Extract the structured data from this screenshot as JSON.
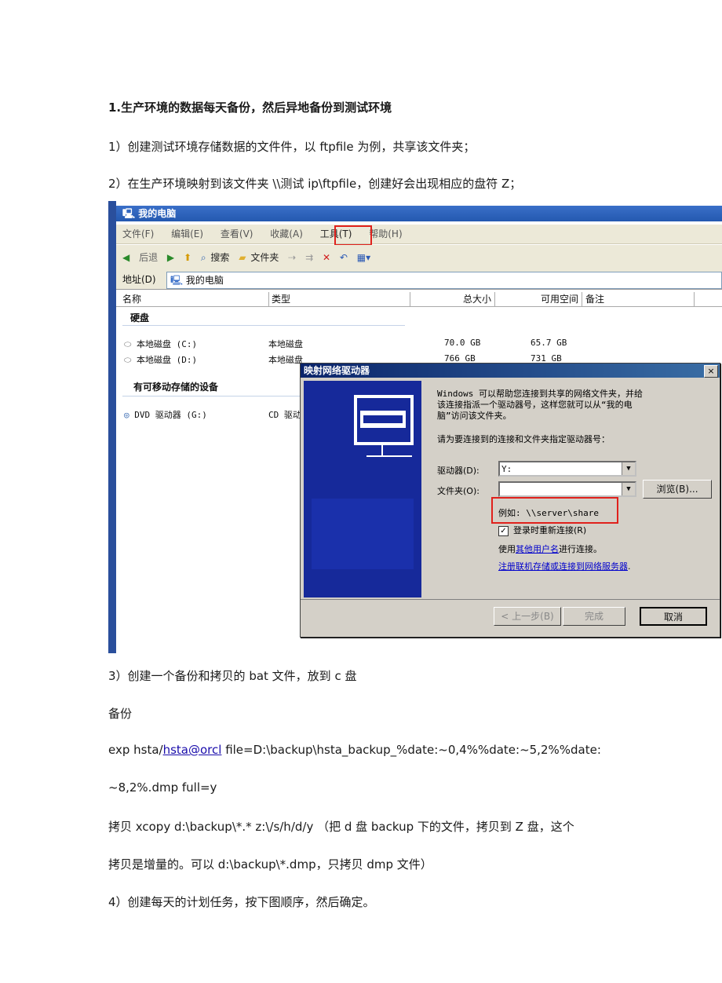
{
  "doc": {
    "heading": "1.生产环境的数据每天备份，然后异地备份到测试环境",
    "step1": "1）创建测试环境存储数据的文件件，以 ftpfile 为例，共享该文件夹；",
    "step2": "2）在生产环境映射到该文件夹 \\\\测试 ip\\ftpfile，创建好会出现相应的盘符 Z；",
    "step3": "3）创建一个备份和拷贝的 bat 文件，放到 c 盘",
    "backup_label": "备份",
    "exp_prefix": "exp hsta/",
    "exp_link": "hsta@orcl",
    "exp_suffix": " file=D:\\backup\\hsta_backup_%date:~0,4%%date:~5,2%%date:",
    "exp_cont": "~8,2%.dmp full=y",
    "copy_line1": "拷贝 xcopy d:\\backup\\*.* z:\\/s/h/d/y （把 d 盘 backup 下的文件，拷贝到 Z 盘，这个",
    "copy_line2": "拷贝是增量的。可以 d:\\backup\\*.dmp，只拷贝 dmp 文件）",
    "step4": "4）创建每天的计划任务，按下图顺序，然后确定。"
  },
  "explorer": {
    "title": "我的电脑",
    "menu": [
      "文件(F)",
      "编辑(E)",
      "查看(V)",
      "收藏(A)",
      "工具(T)",
      "帮助(H)"
    ],
    "toolbar": {
      "back": "后退",
      "search": "搜索",
      "folders": "文件夹"
    },
    "address_label": "地址(D)",
    "address_value": "我的电脑",
    "columns": [
      "名称",
      "类型",
      "总大小",
      "可用空间",
      "备注"
    ],
    "group_hdd": "硬盘",
    "group_removable": "有可移动存储的设备",
    "drives": [
      {
        "name": "本地磁盘 (C:)",
        "type": "本地磁盘",
        "total": "70.0 GB",
        "free": "65.7 GB"
      },
      {
        "name": "本地磁盘 (D:)",
        "type": "本地磁盘",
        "total": "766 GB",
        "free": "731 GB"
      }
    ],
    "dvd": {
      "name": "DVD 驱动器 (G:)",
      "type": "CD 驱动"
    }
  },
  "dialog": {
    "title": "映射网络驱动器",
    "close": "×",
    "intro": "Windows 可以帮助您连接到共享的网络文件夹，并给该连接指派一个驱动器号，这样您就可以从“我的电脑”访问该文件夹。",
    "intro_l1": "Windows 可以帮助您连接到共享的网络文件夹，并给",
    "intro_l2": "该连接指派一个驱动器号，这样您就可以从“我的电",
    "intro_l3": "脑”访问该文件夹。",
    "prompt": "请为要连接到的连接和文件夹指定驱动器号：",
    "drive_label": "驱动器(D):",
    "drive_value": "Y:",
    "folder_label": "文件夹(O):",
    "folder_value": "",
    "browse": "浏览(B)...",
    "example": "例如: \\\\server\\share",
    "reconnect": "登录时重新连接(R)",
    "reconnect_checked": true,
    "other_user_prefix": "使用",
    "other_user_link": "其他用户名",
    "other_user_suffix": "进行连接。",
    "register_link": "注册联机存储或连接到网络服务器",
    "back_btn": "< 上一步(B)",
    "finish_btn": "完成",
    "cancel_btn": "取消"
  }
}
